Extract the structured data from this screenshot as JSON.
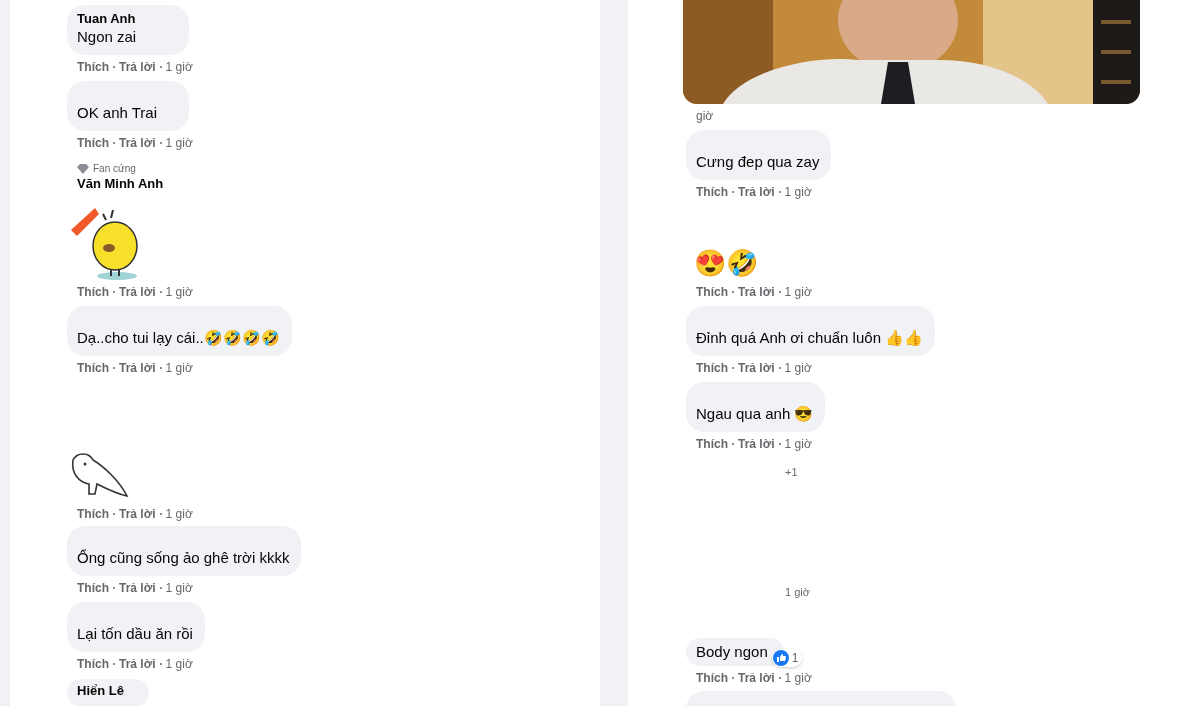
{
  "left_column": [
    {
      "kind": "text",
      "name": "Tuan Anh",
      "text": "Ngon zai",
      "meta": {
        "like": "Thích",
        "reply": "Trả lời",
        "time": "1 giờ"
      }
    },
    {
      "kind": "text",
      "text": "OK anh Trai",
      "meta": {
        "like": "Thích",
        "reply": "Trả lời",
        "time": "1 giờ"
      }
    },
    {
      "kind": "sticker",
      "sticker": {
        "kind": "chick"
      },
      "badge": "Fan cứng",
      "name": "Văn Minh Anh",
      "meta": {
        "like": "Thích",
        "reply": "Trả lời",
        "time": "1 giờ"
      }
    },
    {
      "kind": "text",
      "text": "Dạ..cho tui lạy cái..🤣🤣🤣🤣",
      "meta": {
        "like": "Thích",
        "reply": "Trả lời",
        "time": "1 giờ"
      }
    },
    {
      "kind": "sticker",
      "sticker": {
        "kind": "doodle"
      },
      "meta": {
        "like": "Thích",
        "reply": "Trả lời",
        "time": "1 giờ"
      }
    },
    {
      "kind": "text",
      "text": "Ổng cũng sống ảo ghê trời kkkk",
      "meta": {
        "like": "Thích",
        "reply": "Trả lời",
        "time": "1 giờ"
      }
    },
    {
      "kind": "text",
      "text": "Lại tốn dầu ăn rồi",
      "meta": {
        "like": "Thích",
        "reply": "Trả lời",
        "time": "1 giờ"
      }
    },
    {
      "kind": "name-only",
      "name": "Hiển Lê"
    }
  ],
  "right_column": [
    {
      "kind": "picture",
      "meta": {
        "time": "giờ"
      }
    },
    {
      "kind": "text",
      "text": "Cưng đep qua zay",
      "meta": {
        "like": "Thích",
        "reply": "Trả lời",
        "time": "1 giờ"
      }
    },
    {
      "kind": "emoji",
      "text": "😍🤣",
      "meta": {
        "like": "Thích",
        "reply": "Trả lời",
        "time": "1 giờ"
      }
    },
    {
      "kind": "text",
      "text": "Đỉnh quá Anh ơi chuẩn luôn 👍👍",
      "meta": {
        "like": "Thích",
        "reply": "Trả lời",
        "time": "1 giờ"
      }
    },
    {
      "kind": "text",
      "text": "Ngau qua anh 😎",
      "meta": {
        "like": "Thích",
        "reply": "Trả lời",
        "time": "1 giờ"
      }
    },
    {
      "kind": "note",
      "text": "+1"
    },
    {
      "kind": "note",
      "text": "1 giờ"
    },
    {
      "kind": "plain",
      "text": "Body ngon",
      "reaction": {
        "count": "1"
      },
      "meta": {
        "like": "Thích",
        "reply": "Trả lời",
        "time": "1 giờ"
      }
    },
    {
      "kind": "blank"
    }
  ]
}
